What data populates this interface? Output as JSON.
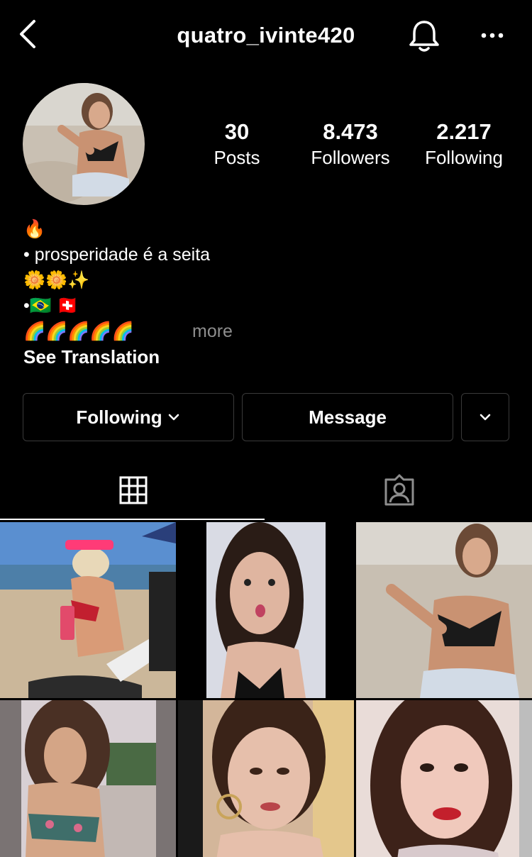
{
  "header": {
    "username": "quatro_ivinte420"
  },
  "profile": {
    "stats": [
      {
        "value": "30",
        "label": "Posts"
      },
      {
        "value": "8.473",
        "label": "Followers"
      },
      {
        "value": "2.217",
        "label": "Following"
      }
    ],
    "bio": {
      "line1": "🔥",
      "line2": "• prosperidade é a seita",
      "line3": "🌼🌼✨",
      "line4": "•🇧🇷 🇨🇭",
      "line5": "🌈🌈🌈🌈🌈",
      "more": "more",
      "see_translation": "See Translation"
    }
  },
  "actions": {
    "following_label": "Following",
    "message_label": "Message"
  },
  "tabs": {
    "grid_icon": "grid-icon",
    "tagged_icon": "tagged-icon"
  },
  "colors": {
    "background": "#000000",
    "text": "#ffffff",
    "muted": "#8e8e8e",
    "border": "#3a3a3a"
  },
  "posts": [
    {
      "id": "post-1"
    },
    {
      "id": "post-2"
    },
    {
      "id": "post-3"
    },
    {
      "id": "post-4"
    },
    {
      "id": "post-5"
    },
    {
      "id": "post-6"
    }
  ]
}
